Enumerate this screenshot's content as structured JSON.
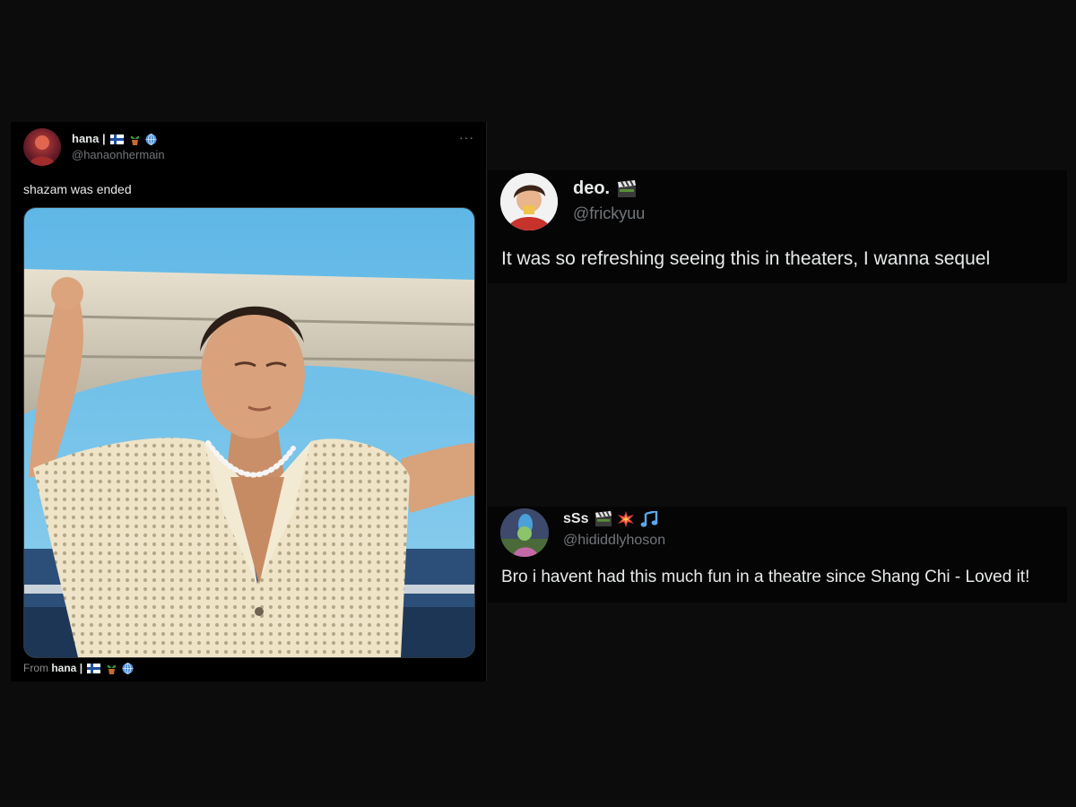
{
  "tweet_left": {
    "name": "hana",
    "name_separator": "|",
    "handle": "@hanaonhermain",
    "more_label": "···",
    "text": "shazam was ended",
    "from_prefix": "From",
    "from_name": "hana",
    "icons": [
      "finland-flag-icon",
      "potted-plant-icon",
      "globe-icon"
    ]
  },
  "tweet_right_1": {
    "name": "deo.",
    "handle": "@frickyuu",
    "text": "It was so refreshing seeing this in theaters, I wanna sequel",
    "icons": [
      "clapper-board-icon"
    ]
  },
  "tweet_right_2": {
    "name": "sSs",
    "handle": "@hididdlyhoson",
    "text": "Bro i havent had this much fun in a theatre since Shang Chi - Loved it!",
    "icons": [
      "clapper-board-icon",
      "collision-icon",
      "music-notes-icon"
    ]
  },
  "colors": {
    "background": "#0c0c0c",
    "tweet_bg": "#000000",
    "text_primary": "#e7e9ea",
    "text_secondary": "#71767b"
  }
}
